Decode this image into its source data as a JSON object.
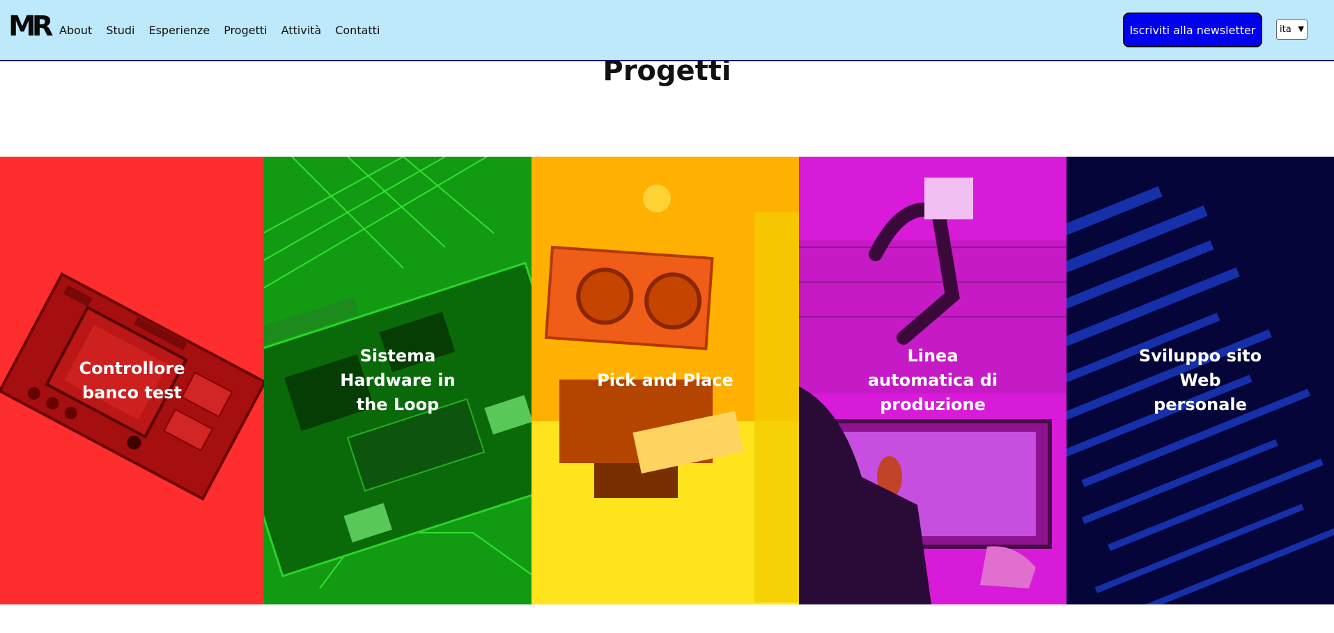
{
  "navbar": {
    "logo_text": "MR",
    "links": [
      "About",
      "Studi",
      "Esperienze",
      "Progetti",
      "Attività",
      "Contatti"
    ],
    "newsletter_label": "Iscriviti alla newsletter",
    "language_selected": "ita"
  },
  "main": {
    "section_title": "Progetti",
    "cards": [
      {
        "title": "Controllore banco test",
        "color": "#ff2e2e"
      },
      {
        "title": "Sistema Hardware in the Loop",
        "color": "#129a12"
      },
      {
        "title": "Pick and Place",
        "color": "#ffb000"
      },
      {
        "title": "Linea automatica di produzione",
        "color": "#d81bd8"
      },
      {
        "title": "Sviluppo sito Web personale",
        "color": "#05053a"
      }
    ]
  }
}
